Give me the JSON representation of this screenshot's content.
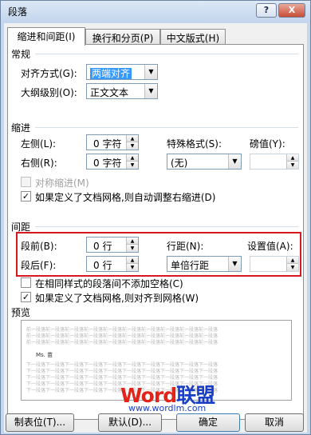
{
  "window": {
    "title": "段落",
    "help_label": "?",
    "close_label": "X"
  },
  "tabs": [
    "缩进和间距(I)",
    "换行和分页(P)",
    "中文版式(H)"
  ],
  "general": {
    "section": "常规",
    "align_label": "对齐方式(G):",
    "align_value": "两端对齐",
    "outline_label": "大纲级别(O):",
    "outline_value": "正文文本"
  },
  "indent": {
    "section": "缩进",
    "left_label": "左侧(L):",
    "left_value": "0 字符",
    "right_label": "右侧(R):",
    "right_value": "0 字符",
    "special_label": "特殊格式(S):",
    "special_value": "(无)",
    "by_label": "磅值(Y):",
    "by_value": "",
    "mirror_label": "对称缩进(M)",
    "auto_adjust_label": "如果定义了文档网格,则自动调整右缩进(D)"
  },
  "spacing": {
    "section": "间距",
    "before_label": "段前(B):",
    "before_value": "0 行",
    "after_label": "段后(F):",
    "after_value": "0 行",
    "line_label": "行距(N):",
    "line_value": "单倍行距",
    "at_label": "设置值(A):",
    "at_value": "",
    "no_space_label": "在相同样式的段落间不添加空格(C)",
    "snap_grid_label": "如果定义了文档网格,则对齐到网格(W)"
  },
  "preview": {
    "section": "预览",
    "filler_text": "前一段落前一段落前一段落前一段落前一段落前一段落前一段落前一段落前一段落前一段落",
    "follow_text": "下一段落下一段落下一段落下一段落下一段落下一段落下一段落下一段落下一段落下一段落",
    "sample": "Ms. 苗"
  },
  "buttons": {
    "tabs_label": "制表位(T)...",
    "default_label": "默认(D)...",
    "ok_label": "确定",
    "cancel_label": "取消"
  },
  "watermark": {
    "brand_a": "Word",
    "brand_b": "联盟",
    "url": "www.wordlm.com"
  },
  "colors": {
    "highlight_box": "#d9171f",
    "selection": "#3399ff"
  }
}
